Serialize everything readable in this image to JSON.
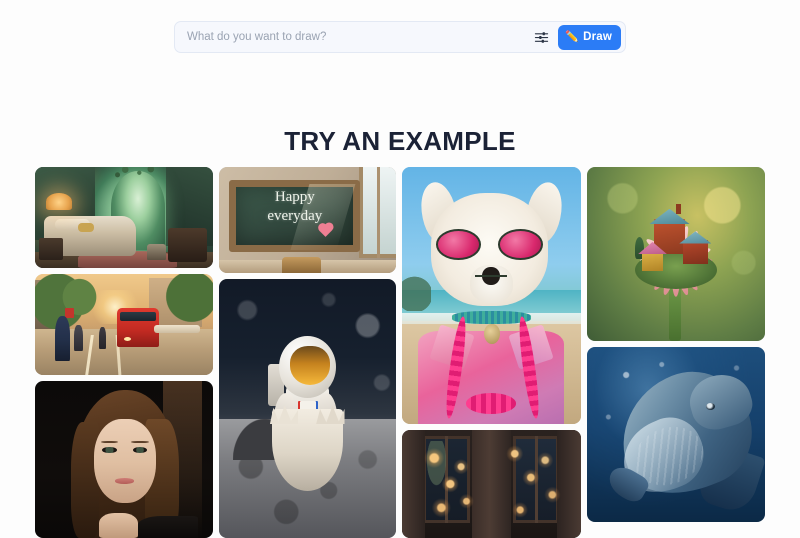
{
  "page": {
    "background_color": "#fdfdfd"
  },
  "prompt_bar": {
    "input_value": "",
    "placeholder": "What do you want to draw?",
    "settings_icon": "sliders-icon",
    "draw_button": {
      "label": "Draw",
      "icon": "pencil-icon",
      "glyph": "✏️",
      "background_color": "#2b7cf6",
      "text_color": "#ffffff"
    }
  },
  "gallery": {
    "title": "TRY AN EXAMPLE",
    "title_color": "#1b2236",
    "columns": [
      {
        "id": "column-1",
        "tiles": [
          {
            "id": "enchanted-bedroom",
            "alt": "Bedroom with a glowing forest portal in the wall"
          },
          {
            "id": "tram-street",
            "alt": "Red tram on a sunlit tree-lined city street"
          },
          {
            "id": "woman-portrait",
            "alt": "Portrait of a smiling woman on a dark background"
          }
        ]
      },
      {
        "id": "column-2",
        "tiles": [
          {
            "id": "happy-everyday-chalkboard",
            "alt": "Classroom chalkboard reading Happy everyday",
            "chalk_line_1": "Happy",
            "chalk_line_2": "everyday"
          },
          {
            "id": "moon-astronaut-egg",
            "alt": "Toy astronaut hatching from an eggshell on the moon"
          }
        ]
      },
      {
        "id": "column-3",
        "tiles": [
          {
            "id": "beach-dog-sunglasses",
            "alt": "White terrier in pink shirt and sunglasses at the beach"
          },
          {
            "id": "cozy-window-lights",
            "alt": "Cozy window framed by warm fairy lights at night"
          }
        ]
      },
      {
        "id": "column-4",
        "tiles": [
          {
            "id": "flower-village",
            "alt": "Miniature houses built on a pink daisy flower"
          },
          {
            "id": "deep-sea-whale",
            "alt": "Humpback whale swimming in starry deep blue water"
          }
        ]
      }
    ]
  }
}
